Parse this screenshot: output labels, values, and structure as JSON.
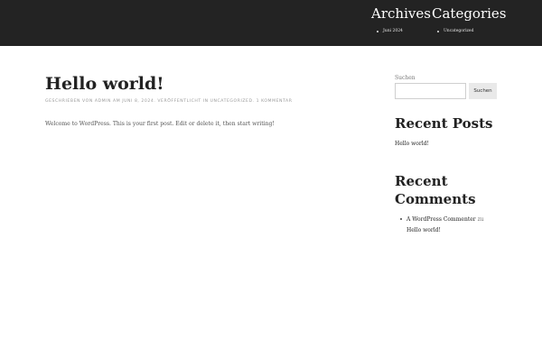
{
  "header": {
    "archives": {
      "title": "Archives",
      "items": [
        "Juni 2024"
      ]
    },
    "categories": {
      "title": "Categories",
      "items": [
        "Uncategorized"
      ]
    }
  },
  "post": {
    "title": "Hello world!",
    "meta": "GESCHRIEBEN VON ADMIN AM JUNI 8, 2024. VERÖFFENTLICHT IN UNCATEGORIZED. 1 KOMMENTAR",
    "content": "Welcome to WordPress. This is your first post. Edit or delete it, then start writing!"
  },
  "sidebar": {
    "search": {
      "label": "Suchen",
      "value": "",
      "button": "Suchen"
    },
    "recent_posts": {
      "title": "Recent Posts",
      "items": [
        "Hello world!"
      ]
    },
    "recent_comments": {
      "title": "Recent Comments",
      "author": "A WordPress Commenter",
      "on": "zu",
      "post": "Hello world!"
    }
  }
}
